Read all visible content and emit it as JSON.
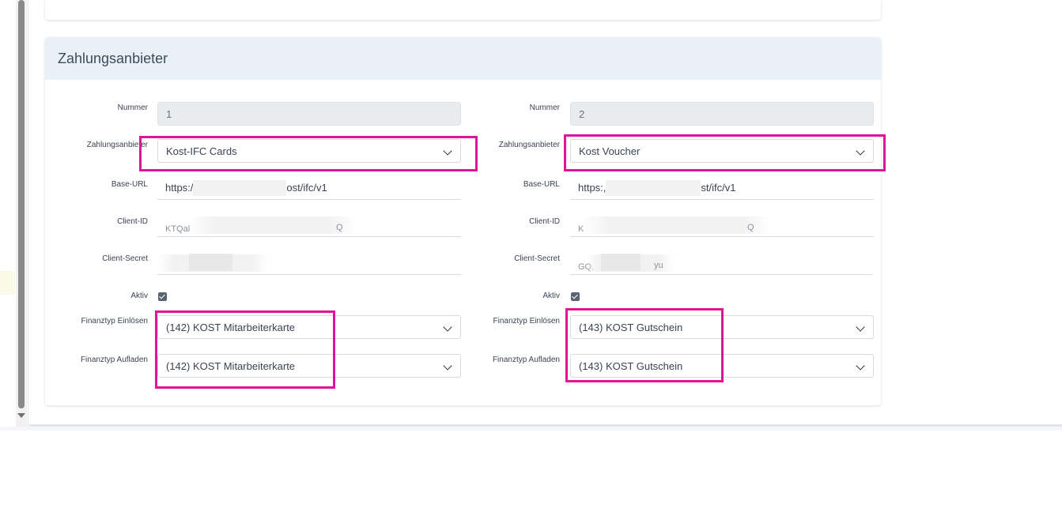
{
  "section": {
    "title": "Zahlungsanbieter"
  },
  "colors": {
    "highlight": "#e0149b",
    "header_bg": "#eaf0f8"
  },
  "left": {
    "nummer_label": "Nummer",
    "nummer_value": "1",
    "anbieter_label": "Zahlungsanbieter",
    "anbieter_value": "Kost-IFC Cards",
    "baseurl_label": "Base-URL",
    "baseurl_prefix": "https:/",
    "baseurl_suffix": "ost/ifc/v1",
    "clientid_label": "Client-ID",
    "clientid_visible": "KTQal",
    "clientid_tail": "Q",
    "secret_label": "Client-Secret",
    "secret_visible": "",
    "aktiv_label": "Aktiv",
    "einloesen_label": "Finanztyp Einlösen",
    "einloesen_value": "(142) KOST Mitarbeiterkarte",
    "aufladen_label": "Finanztyp Aufladen",
    "aufladen_value": "(142) KOST Mitarbeiterkarte"
  },
  "right": {
    "nummer_label": "Nummer",
    "nummer_value": "2",
    "anbieter_label": "Zahlungsanbieter",
    "anbieter_value": "Kost Voucher",
    "baseurl_label": "Base-URL",
    "baseurl_prefix": "https:,",
    "baseurl_suffix": "st/ifc/v1",
    "clientid_label": "Client-ID",
    "clientid_visible": "K",
    "clientid_tail": "Q",
    "secret_label": "Client-Secret",
    "secret_visible": "GQ,",
    "secret_tail": "yu",
    "aktiv_label": "Aktiv",
    "einloesen_label": "Finanztyp Einlösen",
    "einloesen_value": "(143) KOST Gutschein",
    "aufladen_label": "Finanztyp Aufladen",
    "aufladen_value": "(143) KOST Gutschein"
  }
}
